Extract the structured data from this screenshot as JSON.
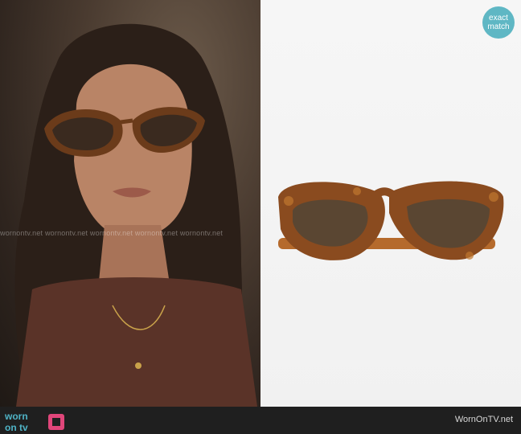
{
  "badge": {
    "line1": "exact",
    "line2": "match"
  },
  "watermark": {
    "text": "wornontv.net wornontv.net wornontv.net wornontv.net wornontv.net"
  },
  "footer": {
    "logo_text_top": "worn",
    "logo_text_bottom": "on tv",
    "site": "WornOnTV.net"
  },
  "colors": {
    "badge": "#5fb7c4",
    "footer": "#1f1f1f",
    "tortoise": "#8a4b1f",
    "lens": "#5a4632"
  }
}
